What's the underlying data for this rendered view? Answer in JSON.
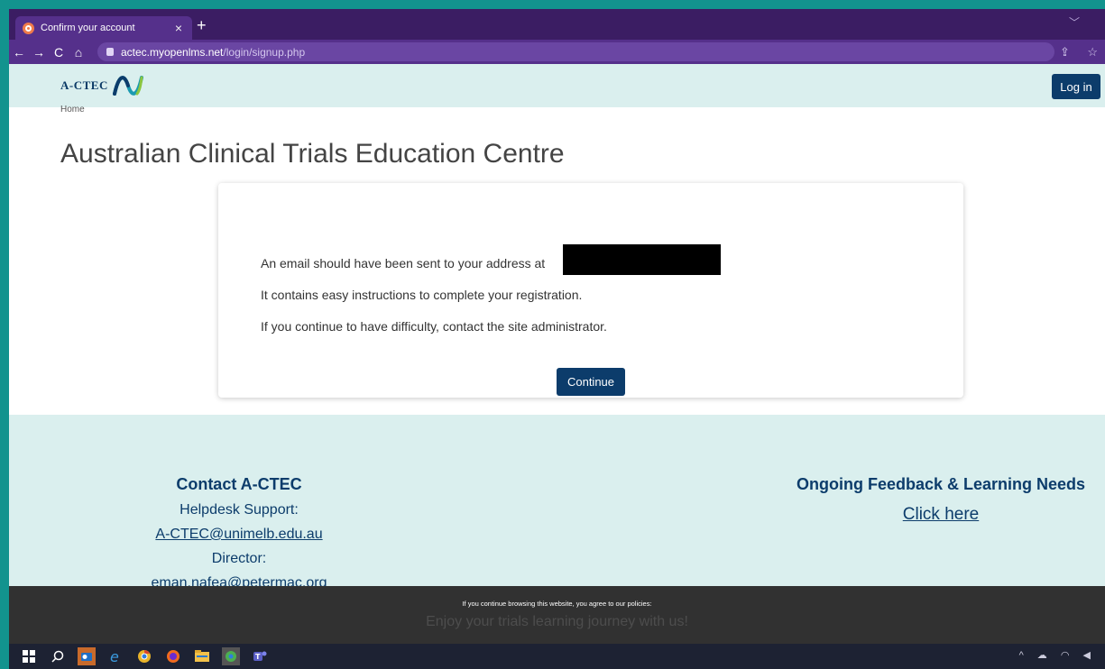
{
  "browser": {
    "tab_title": "Confirm your account",
    "tab_close": "×",
    "new_tab": "+",
    "tab_menu": "﹀",
    "url_host": "actec.myopenlms.net",
    "url_path": "/login/signup.php",
    "nav": {
      "back": "←",
      "forward": "→",
      "reload": "C",
      "home": "⌂"
    },
    "actions": {
      "share": "⇪",
      "bookmark": "☆"
    }
  },
  "header": {
    "logo_text": "A-CTEC",
    "login_label": "Log in"
  },
  "breadcrumb": "Home",
  "page_title": "Australian Clinical Trials Education Centre",
  "card": {
    "line1": "An email should have been sent to your address at",
    "line2": "It contains easy instructions to complete your registration.",
    "line3": "If you continue to have difficulty, contact the site administrator.",
    "continue_label": "Continue"
  },
  "footer": {
    "contact_heading": "Contact A-CTEC",
    "helpdesk_label": "Helpdesk Support:",
    "helpdesk_email": "A-CTEC@unimelb.edu.au",
    "director_label": "Director:",
    "director_email": "eman.nafea@petermac.org",
    "feedback_heading": "Ongoing Feedback & Learning Needs",
    "feedback_link": "Click here"
  },
  "cookie": {
    "message": "If you continue browsing this website, you agree to our policies:",
    "behind_text": "Enjoy your trials learning journey with us!"
  },
  "colors": {
    "brand_dark": "#0c3c6b",
    "header_bg": "#daefee",
    "browser_purple": "#55308b",
    "frame_teal": "#12938e"
  },
  "taskbar_icons": [
    "windows-icon",
    "search-icon",
    "outlook-icon",
    "edge-icon",
    "chrome-icon",
    "firefox-icon",
    "file-explorer-icon",
    "chrome-profile-icon",
    "teams-icon"
  ]
}
